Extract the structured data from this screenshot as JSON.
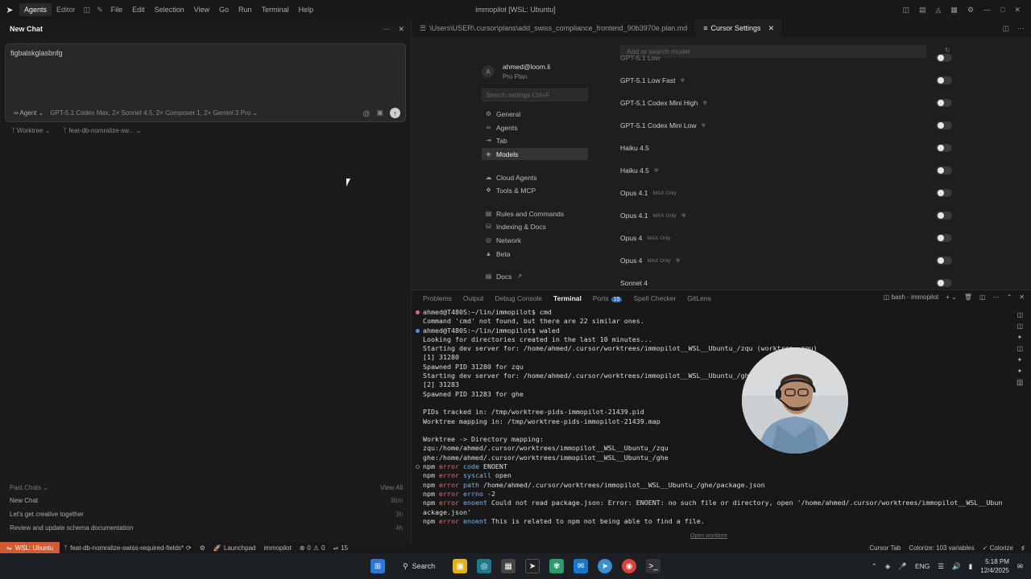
{
  "titlebar": {
    "tabs": [
      "Agents",
      "Editor"
    ],
    "active_tab": "Agents",
    "menu": [
      "File",
      "Edit",
      "Selection",
      "View",
      "Go",
      "Run",
      "Terminal",
      "Help"
    ],
    "window_title": "immopilot [WSL: Ubuntu]"
  },
  "left_panel": {
    "title": "New Chat",
    "input_text": "figbalskglasbnfg",
    "agent_mode": "Agent",
    "models": "GPT-5.1 Codex Max, 2× Sonnet 4.5, 2× Composer 1, 2× Gemini 3 Pro",
    "worktree": "Worktree",
    "branch": "feat-db-nomralize-sw...",
    "past_chats_label": "Past Chats",
    "view_all": "View All",
    "past_chats": [
      {
        "title": "New Chat",
        "time": "36m"
      },
      {
        "title": "Let's get creative together",
        "time": "3h"
      },
      {
        "title": "Review and update schema documentation",
        "time": "4h"
      }
    ]
  },
  "editor_tabs": [
    {
      "label": "\\Users\\USER\\.cursor\\plans\\add_swiss_compliance_frontend_90b3970e.plan.md",
      "active": false
    },
    {
      "label": "Cursor Settings",
      "active": true
    }
  ],
  "settings": {
    "user_initial": "A",
    "user_email": "ahmed@loom.li",
    "user_plan": "Pro Plan",
    "search_placeholder": "Search settings Ctrl+F",
    "nav": [
      {
        "label": "General",
        "icon": "gear-icon"
      },
      {
        "label": "Agents",
        "icon": "infinity-icon"
      },
      {
        "label": "Tab",
        "icon": "tab-icon"
      },
      {
        "label": "Models",
        "icon": "cube-icon",
        "active": true
      },
      {
        "label": "Cloud Agents",
        "icon": "cloud-icon"
      },
      {
        "label": "Tools & MCP",
        "icon": "tools-icon"
      },
      {
        "label": "Rules and Commands",
        "icon": "rules-icon"
      },
      {
        "label": "Indexing & Docs",
        "icon": "database-icon"
      },
      {
        "label": "Network",
        "icon": "globe-icon"
      },
      {
        "label": "Beta",
        "icon": "flask-icon"
      },
      {
        "label": "Docs",
        "icon": "book-icon"
      }
    ],
    "add_model_placeholder": "Add or search model",
    "models": [
      {
        "name": "GPT-5.1 Low",
        "tag": "",
        "brain": false
      },
      {
        "name": "GPT-5.1 Low Fast",
        "tag": "",
        "brain": true
      },
      {
        "name": "GPT-5.1 Codex Mini High",
        "tag": "",
        "brain": true
      },
      {
        "name": "GPT-5.1 Codex Mini Low",
        "tag": "",
        "brain": true
      },
      {
        "name": "Haiku 4.5",
        "tag": "",
        "brain": false
      },
      {
        "name": "Haiku 4.5",
        "tag": "",
        "brain": true
      },
      {
        "name": "Opus 4.1",
        "tag": "MAX Only",
        "brain": false
      },
      {
        "name": "Opus 4.1",
        "tag": "MAX Only",
        "brain": true
      },
      {
        "name": "Opus 4",
        "tag": "MAX Only",
        "brain": false
      },
      {
        "name": "Opus 4",
        "tag": "MAX Only",
        "brain": true
      },
      {
        "name": "Sonnet 4",
        "tag": "",
        "brain": false
      }
    ]
  },
  "panel": {
    "tabs": [
      "Problems",
      "Output",
      "Debug Console",
      "Terminal",
      "Ports",
      "Spell Checker",
      "GitLens"
    ],
    "active_tab": "Terminal",
    "ports_count": "15",
    "shell_label": "bash - immopilot",
    "open_worktree": "Open worktree",
    "terminal_lines": [
      "ahmed@T480S:~/lin/immopilot$ cmd",
      "Command 'cmd' not found, but there are 22 similar ones.",
      "ahmed@T480S:~/lin/immopilot$ waled",
      "Looking for directories created in the last 10 minutes...",
      "Starting dev server for: /home/ahmed/.cursor/worktrees/immopilot__WSL__Ubuntu_/zqu (worktree: zqu)",
      "[1] 31280",
      "Spawned PID 31280 for zqu",
      "Starting dev server for: /home/ahmed/.cursor/worktrees/immopilot__WSL__Ubuntu_/ghe (worktree: ghe)",
      "[2] 31283",
      "Spawned PID 31283 for ghe",
      "",
      "PIDs tracked in: /tmp/worktree-pids-immopilot-21439.pid",
      "Worktree mapping in: /tmp/worktree-pids-immopilot-21439.map",
      "",
      "Worktree -> Directory mapping:",
      "zqu:/home/ahmed/.cursor/worktrees/immopilot__WSL__Ubuntu_/zqu",
      "ghe:/home/ahmed/.cursor/worktrees/immopilot__WSL__Ubuntu_/ghe",
      "npm error code ENOENT",
      "npm error syscall open",
      "npm error path /home/ahmed/.cursor/worktrees/immopilot__WSL__Ubuntu_/ghe/package.json",
      "npm error errno -2",
      "npm error enoent Could not read package.json: Error: ENOENT: no such file or directory, open '/home/ahmed/.cursor/worktrees/immopilot__WSL__Ubuntu_/ghe/p",
      "ackage.json'",
      "npm error enoent This is related to npm not being able to find a file."
    ]
  },
  "statusbar": {
    "remote": "WSL: Ubuntu",
    "branch": "feat-db-nomralize-swiss-required-fields*",
    "launchpad": "Launchpad",
    "project": "immopilot",
    "errors": "0",
    "warnings": "0",
    "ports": "15",
    "cursor_tab": "Cursor Tab",
    "colorize_vars": "Colorize: 103 variables",
    "colorize": "Colorize"
  },
  "taskbar": {
    "search": "Search",
    "lang": "ENG",
    "time": "5:18 PM",
    "date": "12/4/2025"
  },
  "colors": {
    "accent_remote": "#d35b33",
    "error_text": "#e06c75",
    "ports_badge": "#2f6fb7"
  }
}
